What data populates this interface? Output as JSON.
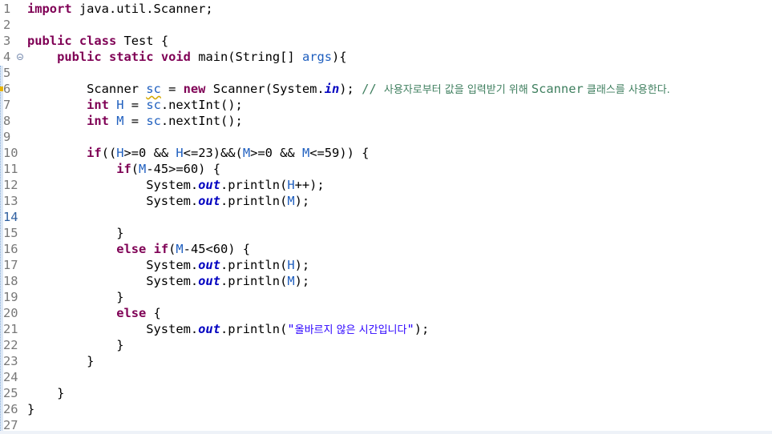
{
  "editor": {
    "lines": [
      {
        "num": "1",
        "tokens": [
          {
            "t": "import",
            "c": "kw"
          },
          {
            "t": " java.util.Scanner;"
          }
        ]
      },
      {
        "num": "2",
        "tokens": []
      },
      {
        "num": "3",
        "tokens": [
          {
            "t": "public",
            "c": "kw"
          },
          {
            "t": " "
          },
          {
            "t": "class",
            "c": "kw"
          },
          {
            "t": " Test {"
          }
        ]
      },
      {
        "num": "4",
        "fold": true,
        "tokens": [
          {
            "t": "    "
          },
          {
            "t": "public",
            "c": "kw"
          },
          {
            "t": " "
          },
          {
            "t": "static",
            "c": "kw"
          },
          {
            "t": " "
          },
          {
            "t": "void",
            "c": "kw"
          },
          {
            "t": " main(String[] "
          },
          {
            "t": "args",
            "c": "lb"
          },
          {
            "t": "){"
          }
        ]
      },
      {
        "num": "5",
        "tokens": []
      },
      {
        "num": "6",
        "tokens": [
          {
            "t": "        Scanner "
          },
          {
            "t": "sc",
            "c": "lb warn"
          },
          {
            "t": " = "
          },
          {
            "t": "new",
            "c": "kw"
          },
          {
            "t": " Scanner(System."
          },
          {
            "t": "in",
            "c": "fld"
          },
          {
            "t": "); "
          },
          {
            "t": "// ",
            "c": "cmt"
          },
          {
            "t": "사용자로부터 값을 입력받기 위해 ",
            "c": "cmt-ko"
          },
          {
            "t": "Scanner",
            "c": "cmt"
          },
          {
            "t": " 클래스를 사용한다.",
            "c": "cmt-ko"
          }
        ]
      },
      {
        "num": "7",
        "tokens": [
          {
            "t": "        "
          },
          {
            "t": "int",
            "c": "kw"
          },
          {
            "t": " "
          },
          {
            "t": "H",
            "c": "lb"
          },
          {
            "t": " = "
          },
          {
            "t": "sc",
            "c": "lb"
          },
          {
            "t": ".nextInt();"
          }
        ]
      },
      {
        "num": "8",
        "tokens": [
          {
            "t": "        "
          },
          {
            "t": "int",
            "c": "kw"
          },
          {
            "t": " "
          },
          {
            "t": "M",
            "c": "lb"
          },
          {
            "t": " = "
          },
          {
            "t": "sc",
            "c": "lb"
          },
          {
            "t": ".nextInt();"
          }
        ]
      },
      {
        "num": "9",
        "tokens": []
      },
      {
        "num": "10",
        "tokens": [
          {
            "t": "        "
          },
          {
            "t": "if",
            "c": "kw"
          },
          {
            "t": "(("
          },
          {
            "t": "H",
            "c": "lb"
          },
          {
            "t": ">=0 && "
          },
          {
            "t": "H",
            "c": "lb"
          },
          {
            "t": "<=23)&&("
          },
          {
            "t": "M",
            "c": "lb"
          },
          {
            "t": ">=0 && "
          },
          {
            "t": "M",
            "c": "lb"
          },
          {
            "t": "<=59)) {"
          }
        ]
      },
      {
        "num": "11",
        "tokens": [
          {
            "t": "            "
          },
          {
            "t": "if",
            "c": "kw"
          },
          {
            "t": "("
          },
          {
            "t": "M",
            "c": "lb"
          },
          {
            "t": "-45>=60) {"
          }
        ]
      },
      {
        "num": "12",
        "tokens": [
          {
            "t": "                System."
          },
          {
            "t": "out",
            "c": "fld"
          },
          {
            "t": ".println("
          },
          {
            "t": "H",
            "c": "lb"
          },
          {
            "t": "++);"
          }
        ]
      },
      {
        "num": "13",
        "tokens": [
          {
            "t": "                System."
          },
          {
            "t": "out",
            "c": "fld"
          },
          {
            "t": ".println("
          },
          {
            "t": "M",
            "c": "lb"
          },
          {
            "t": ");"
          }
        ]
      },
      {
        "num": "14",
        "current": true,
        "tokens": []
      },
      {
        "num": "15",
        "tokens": [
          {
            "t": "            }"
          }
        ]
      },
      {
        "num": "16",
        "tokens": [
          {
            "t": "            "
          },
          {
            "t": "else",
            "c": "kw"
          },
          {
            "t": " "
          },
          {
            "t": "if",
            "c": "kw"
          },
          {
            "t": "("
          },
          {
            "t": "M",
            "c": "lb"
          },
          {
            "t": "-45<60) {"
          }
        ]
      },
      {
        "num": "17",
        "tokens": [
          {
            "t": "                System."
          },
          {
            "t": "out",
            "c": "fld"
          },
          {
            "t": ".println("
          },
          {
            "t": "H",
            "c": "lb"
          },
          {
            "t": ");"
          }
        ]
      },
      {
        "num": "18",
        "tokens": [
          {
            "t": "                System."
          },
          {
            "t": "out",
            "c": "fld"
          },
          {
            "t": ".println("
          },
          {
            "t": "M",
            "c": "lb"
          },
          {
            "t": ");"
          }
        ]
      },
      {
        "num": "19",
        "tokens": [
          {
            "t": "            }"
          }
        ]
      },
      {
        "num": "20",
        "tokens": [
          {
            "t": "            "
          },
          {
            "t": "else",
            "c": "kw"
          },
          {
            "t": " {"
          }
        ]
      },
      {
        "num": "21",
        "tokens": [
          {
            "t": "                System."
          },
          {
            "t": "out",
            "c": "fld"
          },
          {
            "t": ".println("
          },
          {
            "t": "\"",
            "c": "str"
          },
          {
            "t": "올바르지 않은 시간입니다",
            "c": "str-ko"
          },
          {
            "t": "\"",
            "c": "str"
          },
          {
            "t": ");"
          }
        ]
      },
      {
        "num": "22",
        "tokens": [
          {
            "t": "            }"
          }
        ]
      },
      {
        "num": "23",
        "tokens": [
          {
            "t": "        }"
          }
        ]
      },
      {
        "num": "24",
        "tokens": []
      },
      {
        "num": "25",
        "tokens": [
          {
            "t": "    }"
          }
        ]
      },
      {
        "num": "26",
        "tokens": [
          {
            "t": "}"
          }
        ]
      },
      {
        "num": "27",
        "tokens": []
      }
    ]
  }
}
